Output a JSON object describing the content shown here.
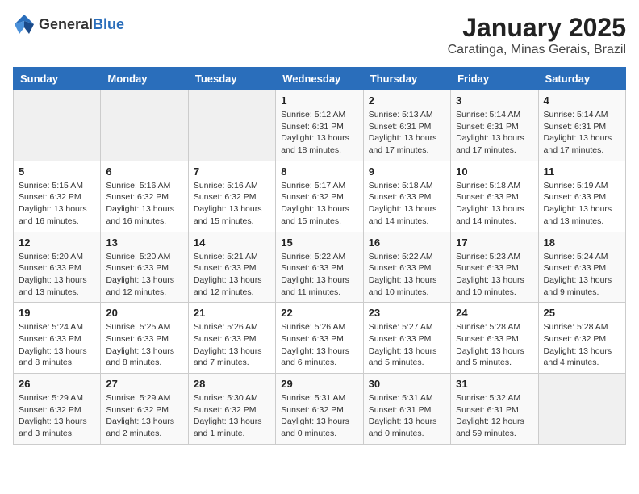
{
  "header": {
    "logo_general": "General",
    "logo_blue": "Blue",
    "title": "January 2025",
    "subtitle": "Caratinga, Minas Gerais, Brazil"
  },
  "weekdays": [
    "Sunday",
    "Monday",
    "Tuesday",
    "Wednesday",
    "Thursday",
    "Friday",
    "Saturday"
  ],
  "weeks": [
    [
      {
        "day": "",
        "info": ""
      },
      {
        "day": "",
        "info": ""
      },
      {
        "day": "",
        "info": ""
      },
      {
        "day": "1",
        "info": "Sunrise: 5:12 AM\nSunset: 6:31 PM\nDaylight: 13 hours\nand 18 minutes."
      },
      {
        "day": "2",
        "info": "Sunrise: 5:13 AM\nSunset: 6:31 PM\nDaylight: 13 hours\nand 17 minutes."
      },
      {
        "day": "3",
        "info": "Sunrise: 5:14 AM\nSunset: 6:31 PM\nDaylight: 13 hours\nand 17 minutes."
      },
      {
        "day": "4",
        "info": "Sunrise: 5:14 AM\nSunset: 6:31 PM\nDaylight: 13 hours\nand 17 minutes."
      }
    ],
    [
      {
        "day": "5",
        "info": "Sunrise: 5:15 AM\nSunset: 6:32 PM\nDaylight: 13 hours\nand 16 minutes."
      },
      {
        "day": "6",
        "info": "Sunrise: 5:16 AM\nSunset: 6:32 PM\nDaylight: 13 hours\nand 16 minutes."
      },
      {
        "day": "7",
        "info": "Sunrise: 5:16 AM\nSunset: 6:32 PM\nDaylight: 13 hours\nand 15 minutes."
      },
      {
        "day": "8",
        "info": "Sunrise: 5:17 AM\nSunset: 6:32 PM\nDaylight: 13 hours\nand 15 minutes."
      },
      {
        "day": "9",
        "info": "Sunrise: 5:18 AM\nSunset: 6:33 PM\nDaylight: 13 hours\nand 14 minutes."
      },
      {
        "day": "10",
        "info": "Sunrise: 5:18 AM\nSunset: 6:33 PM\nDaylight: 13 hours\nand 14 minutes."
      },
      {
        "day": "11",
        "info": "Sunrise: 5:19 AM\nSunset: 6:33 PM\nDaylight: 13 hours\nand 13 minutes."
      }
    ],
    [
      {
        "day": "12",
        "info": "Sunrise: 5:20 AM\nSunset: 6:33 PM\nDaylight: 13 hours\nand 13 minutes."
      },
      {
        "day": "13",
        "info": "Sunrise: 5:20 AM\nSunset: 6:33 PM\nDaylight: 13 hours\nand 12 minutes."
      },
      {
        "day": "14",
        "info": "Sunrise: 5:21 AM\nSunset: 6:33 PM\nDaylight: 13 hours\nand 12 minutes."
      },
      {
        "day": "15",
        "info": "Sunrise: 5:22 AM\nSunset: 6:33 PM\nDaylight: 13 hours\nand 11 minutes."
      },
      {
        "day": "16",
        "info": "Sunrise: 5:22 AM\nSunset: 6:33 PM\nDaylight: 13 hours\nand 10 minutes."
      },
      {
        "day": "17",
        "info": "Sunrise: 5:23 AM\nSunset: 6:33 PM\nDaylight: 13 hours\nand 10 minutes."
      },
      {
        "day": "18",
        "info": "Sunrise: 5:24 AM\nSunset: 6:33 PM\nDaylight: 13 hours\nand 9 minutes."
      }
    ],
    [
      {
        "day": "19",
        "info": "Sunrise: 5:24 AM\nSunset: 6:33 PM\nDaylight: 13 hours\nand 8 minutes."
      },
      {
        "day": "20",
        "info": "Sunrise: 5:25 AM\nSunset: 6:33 PM\nDaylight: 13 hours\nand 8 minutes."
      },
      {
        "day": "21",
        "info": "Sunrise: 5:26 AM\nSunset: 6:33 PM\nDaylight: 13 hours\nand 7 minutes."
      },
      {
        "day": "22",
        "info": "Sunrise: 5:26 AM\nSunset: 6:33 PM\nDaylight: 13 hours\nand 6 minutes."
      },
      {
        "day": "23",
        "info": "Sunrise: 5:27 AM\nSunset: 6:33 PM\nDaylight: 13 hours\nand 5 minutes."
      },
      {
        "day": "24",
        "info": "Sunrise: 5:28 AM\nSunset: 6:33 PM\nDaylight: 13 hours\nand 5 minutes."
      },
      {
        "day": "25",
        "info": "Sunrise: 5:28 AM\nSunset: 6:32 PM\nDaylight: 13 hours\nand 4 minutes."
      }
    ],
    [
      {
        "day": "26",
        "info": "Sunrise: 5:29 AM\nSunset: 6:32 PM\nDaylight: 13 hours\nand 3 minutes."
      },
      {
        "day": "27",
        "info": "Sunrise: 5:29 AM\nSunset: 6:32 PM\nDaylight: 13 hours\nand 2 minutes."
      },
      {
        "day": "28",
        "info": "Sunrise: 5:30 AM\nSunset: 6:32 PM\nDaylight: 13 hours\nand 1 minute."
      },
      {
        "day": "29",
        "info": "Sunrise: 5:31 AM\nSunset: 6:32 PM\nDaylight: 13 hours\nand 0 minutes."
      },
      {
        "day": "30",
        "info": "Sunrise: 5:31 AM\nSunset: 6:31 PM\nDaylight: 13 hours\nand 0 minutes."
      },
      {
        "day": "31",
        "info": "Sunrise: 5:32 AM\nSunset: 6:31 PM\nDaylight: 12 hours\nand 59 minutes."
      },
      {
        "day": "",
        "info": ""
      }
    ]
  ]
}
